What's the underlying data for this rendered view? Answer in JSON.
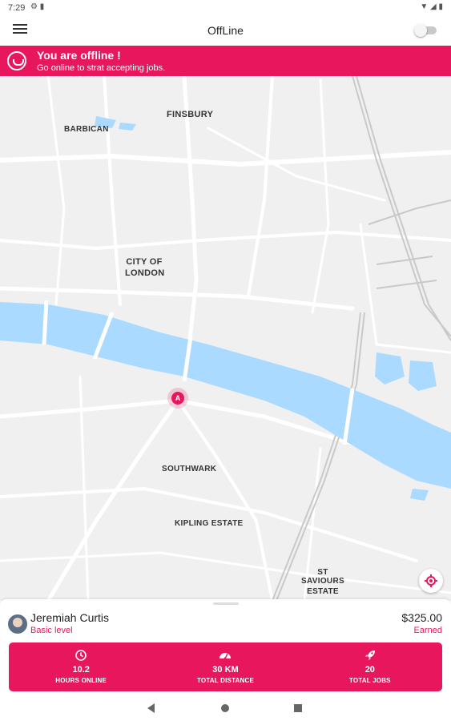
{
  "status_bar": {
    "time": "7:29"
  },
  "app_bar": {
    "title": "OffLine"
  },
  "banner": {
    "heading": "You are offline !",
    "subtext": "Go online to strat accepting jobs."
  },
  "map": {
    "labels": {
      "finsbury": "FINSBURY",
      "barbican": "BARBICAN",
      "city_line1": "CITY OF",
      "city_line2": "LONDON",
      "southwark": "SOUTHWARK",
      "kipling": "KIPLING ESTATE",
      "st_saviours_line1": "ST SAVIOURS",
      "st_saviours_line2": "ESTATE"
    },
    "marker_letter": "A"
  },
  "driver": {
    "name": "Jeremiah Curtis",
    "level": "Basic level",
    "earnings": "$325.00",
    "earnings_label": "Earned"
  },
  "stats": [
    {
      "icon": "clock-icon",
      "value": "10.2",
      "label": "HOURS ONLINE"
    },
    {
      "icon": "speedometer-icon",
      "value": "30 KM",
      "label": "TOTAL DISTANCE"
    },
    {
      "icon": "rocket-icon",
      "value": "20",
      "label": "TOTAL JOBS"
    }
  ],
  "colors": {
    "accent": "#e8175d",
    "river": "#aadaff",
    "map_bg": "#f0f0f0"
  }
}
